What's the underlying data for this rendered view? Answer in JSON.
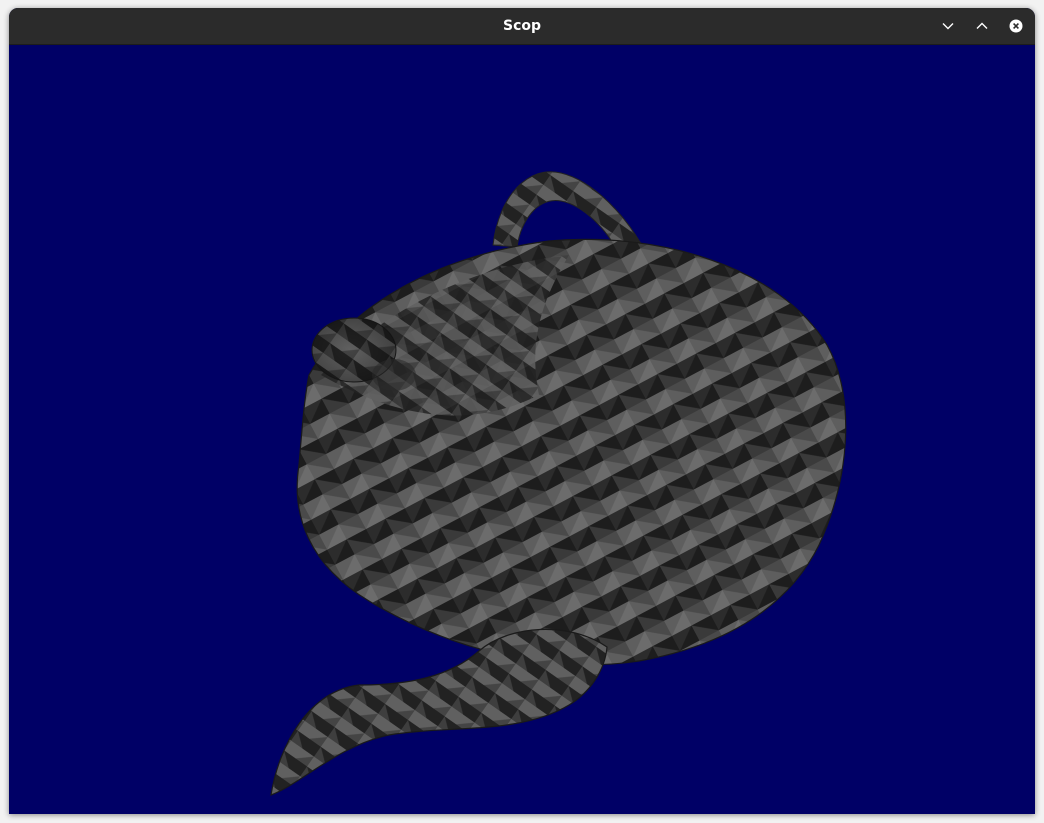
{
  "window": {
    "title": "Scop",
    "buttons": [
      {
        "name": "minimize",
        "icon": "chevron-down-icon"
      },
      {
        "name": "maximize",
        "icon": "chevron-up-icon"
      },
      {
        "name": "close",
        "icon": "close-icon"
      }
    ]
  },
  "viewport": {
    "background_color": "#000066",
    "model": "teapot",
    "shading_colors": [
      "#1c1c1c",
      "#3a3a3a",
      "#5c5c5c",
      "#6a6a6a"
    ]
  }
}
